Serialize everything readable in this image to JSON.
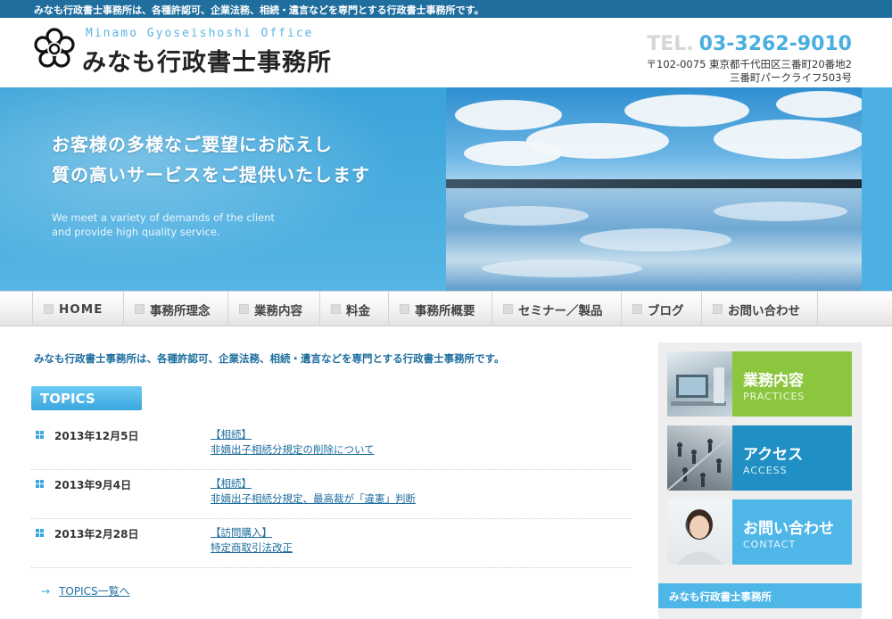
{
  "topbar": {
    "text": "みなも行政書士事務所は、各種許認可、企業法務、相続・遺言などを専門とする行政書士事務所です。"
  },
  "header": {
    "logo_en": "Minamo Gyoseishoshi Office",
    "logo_ja": "みなも行政書士事務所",
    "tel_label": "TEL.",
    "tel_number": "03-3262-9010",
    "address_line1": "〒102-0075 東京都千代田区三番町20番地2",
    "address_line2": "三番町パークライフ503号"
  },
  "hero": {
    "line1": "お客様の多様なご要望にお応えし",
    "line2": "質の高いサービスをご提供いたします",
    "en_line1": "We meet a variety of demands of the client",
    "en_line2": "and provide high quality service."
  },
  "nav": {
    "items": [
      {
        "label": "HOME"
      },
      {
        "label": "事務所理念"
      },
      {
        "label": "業務内容"
      },
      {
        "label": "料金"
      },
      {
        "label": "事務所概要"
      },
      {
        "label": "セミナー／製品"
      },
      {
        "label": "ブログ"
      },
      {
        "label": "お問い合わせ"
      }
    ]
  },
  "main": {
    "intro": "みなも行政書士事務所は、各種許認可、企業法務、相続・遺言などを専門とする行政書士事務所です。",
    "topics_heading": "TOPICS",
    "topics": [
      {
        "date": "2013年12月5日",
        "category": "【相続】",
        "title": "非嫡出子相続分規定の削除について"
      },
      {
        "date": "2013年9月4日",
        "category": "【相続】",
        "title": "非嫡出子相続分規定、最高裁が「違憲」判断"
      },
      {
        "date": "2013年2月28日",
        "category": "【訪問購入】",
        "title": "特定商取引法改正"
      }
    ],
    "more_arrow": "→",
    "more_link": "TOPICS一覧へ"
  },
  "sidebar": {
    "banners": [
      {
        "title": "業務内容",
        "subtitle": "PRACTICES",
        "color": "#8cc63f"
      },
      {
        "title": "アクセス",
        "subtitle": "ACCESS",
        "color": "#1f8fc4"
      },
      {
        "title": "お問い合わせ",
        "subtitle": "CONTACT",
        "color": "#4fb7e8"
      }
    ],
    "heading": "みなも行政書士事務所"
  },
  "colors": {
    "brand_dark": "#1f6e9e",
    "brand_light": "#4aaee0"
  }
}
